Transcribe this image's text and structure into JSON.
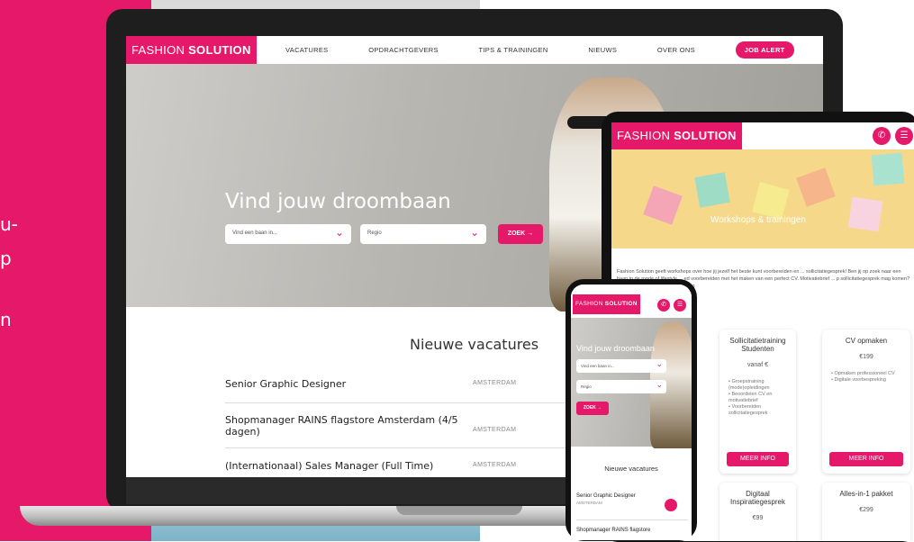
{
  "side_fragment": [
    "u-",
    "p",
    "n"
  ],
  "colors": {
    "brand": "#e6186a"
  },
  "laptop": {
    "logo": {
      "light": "FASHION ",
      "bold": "SOLUTION"
    },
    "nav": [
      "VACATURES",
      "OPDRACHTGEVERS",
      "TIPS & TRAININGEN",
      "NIEUWS",
      "OVER ONS"
    ],
    "job_alert": "JOB ALERT",
    "hero_title": "Vind jouw droombaan",
    "search_placeholder": "Vind een baan in...",
    "region_placeholder": "Regio",
    "zoek": "ZOEK →",
    "section_title": "Nieuwe vacatures",
    "jobs": [
      {
        "title": "Senior Graphic Designer",
        "city": "AMSTERDAM"
      },
      {
        "title": "Shopmanager RAINS flagstore Amsterdam (4/5 dagen)",
        "city": "AMSTERDAM"
      },
      {
        "title": "(Internationaal) Sales Manager (Full Time)",
        "city": "AMSTERDAM"
      }
    ]
  },
  "tablet": {
    "logo": {
      "light": "FASHION ",
      "bold": "SOLUTION"
    },
    "hero_title": "Workshops & trainingen",
    "intro": "Fashion Solution geeft workshops over hoe jij jezelf het beste kunt voorbereiden en ... sollicitatiegesprek! Ben jij op zoek naar een baan in de mode of lifestyle ... ed voorbereiden met het maken van een perfect CV. Motivatiebrief ... p sollicitatiegesprek mag komen? Dan hebben wij de perfecte training",
    "cards": [
      {
        "title": "Sollicitatietraining Studenten",
        "price": "vanaf €",
        "bullets": [
          "• Groepstraining (mode)opleidingen",
          "• Beoordelen CV en motivatiebrief",
          "• Voorbereiden sollicitatiegesprek"
        ],
        "button": "MEER INFO"
      },
      {
        "title": "CV opmaken",
        "price": "€199",
        "bullets": [
          "• Opmaken professioneel CV",
          "• Digitale voorbespreking"
        ],
        "button": "MEER INFO"
      },
      {
        "title": "Digitaal Inspiratiegesprek",
        "price": "€99",
        "bullets": [],
        "button": ""
      },
      {
        "title": "Alles-in-1 pakket",
        "price": "€299",
        "bullets": [],
        "button": ""
      }
    ]
  },
  "phone": {
    "logo": {
      "light": "FASHION ",
      "bold": "SOLUTION"
    },
    "hero_title": "Vind jouw droombaan",
    "search_placeholder": "Vind een baan in...",
    "region_placeholder": "Regio",
    "zoek": "ZOEK →",
    "section_title": "Nieuwe vacatures",
    "jobs": [
      {
        "title": "Senior Graphic Designer",
        "city": "AMSTERDAM"
      },
      {
        "title": "Shopmanager RAINS flagstore",
        "city": ""
      }
    ]
  }
}
